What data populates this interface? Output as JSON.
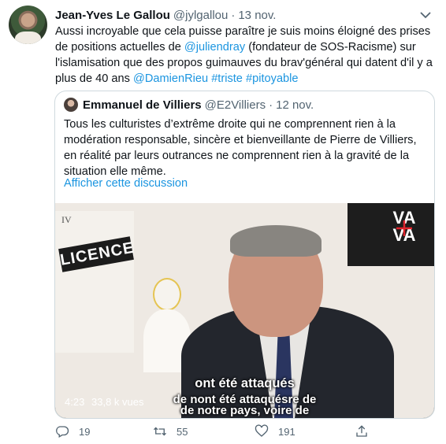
{
  "tweet": {
    "author_name": "Jean-Yves Le Gallou",
    "handle": "@jylgallou",
    "separator": "·",
    "date": "13 nov.",
    "text": {
      "part1": "Aussi incroyable que cela puisse paraître je suis moins éloigné des prises de positions actuelles de ",
      "mention1": "@juliendray",
      "part2": " (fondateur de SOS-Racisme) sur l'islamisation que des propos guimauves du brav'général qui datent d'il y a plus de 40 ans ",
      "mention2": "@DamienRieu",
      "hashtag1": "#triste",
      "hashtag2": "#pitoyable"
    }
  },
  "quoted": {
    "author_name": "Emmanuel de Villiers",
    "handle": "@E2Villiers",
    "separator": "·",
    "date": "12 nov.",
    "text": "Tous les culturistes d’extrême droite qui ne comprennent rien à la modération responsable, sincère et bienveillante de Pierre de Villiers, en réalité par leurs outrances ne comprennent rien à la gravité de la situation elle même.",
    "show_thread": "Afficher cette discussion",
    "video": {
      "duration": "4:23",
      "views": "33,8 k vues",
      "subtitle_line1": "ont été attaqués",
      "subtitle_line2": "de nont été attaquésre de",
      "subtitle_line3": "de notre pays, voire de",
      "poster_numeral": "IV",
      "poster_word": "LICENCE",
      "logo_text": "VA VA"
    }
  },
  "actions": {
    "replies": "19",
    "retweets": "55",
    "likes": "191"
  },
  "icons": {
    "more": "chevron-down-icon",
    "reply": "reply-icon",
    "retweet": "retweet-icon",
    "like": "heart-icon",
    "share": "share-icon"
  },
  "colors": {
    "link": "#1b95e0",
    "secondary_text": "#536471",
    "border": "#cfd9de"
  }
}
